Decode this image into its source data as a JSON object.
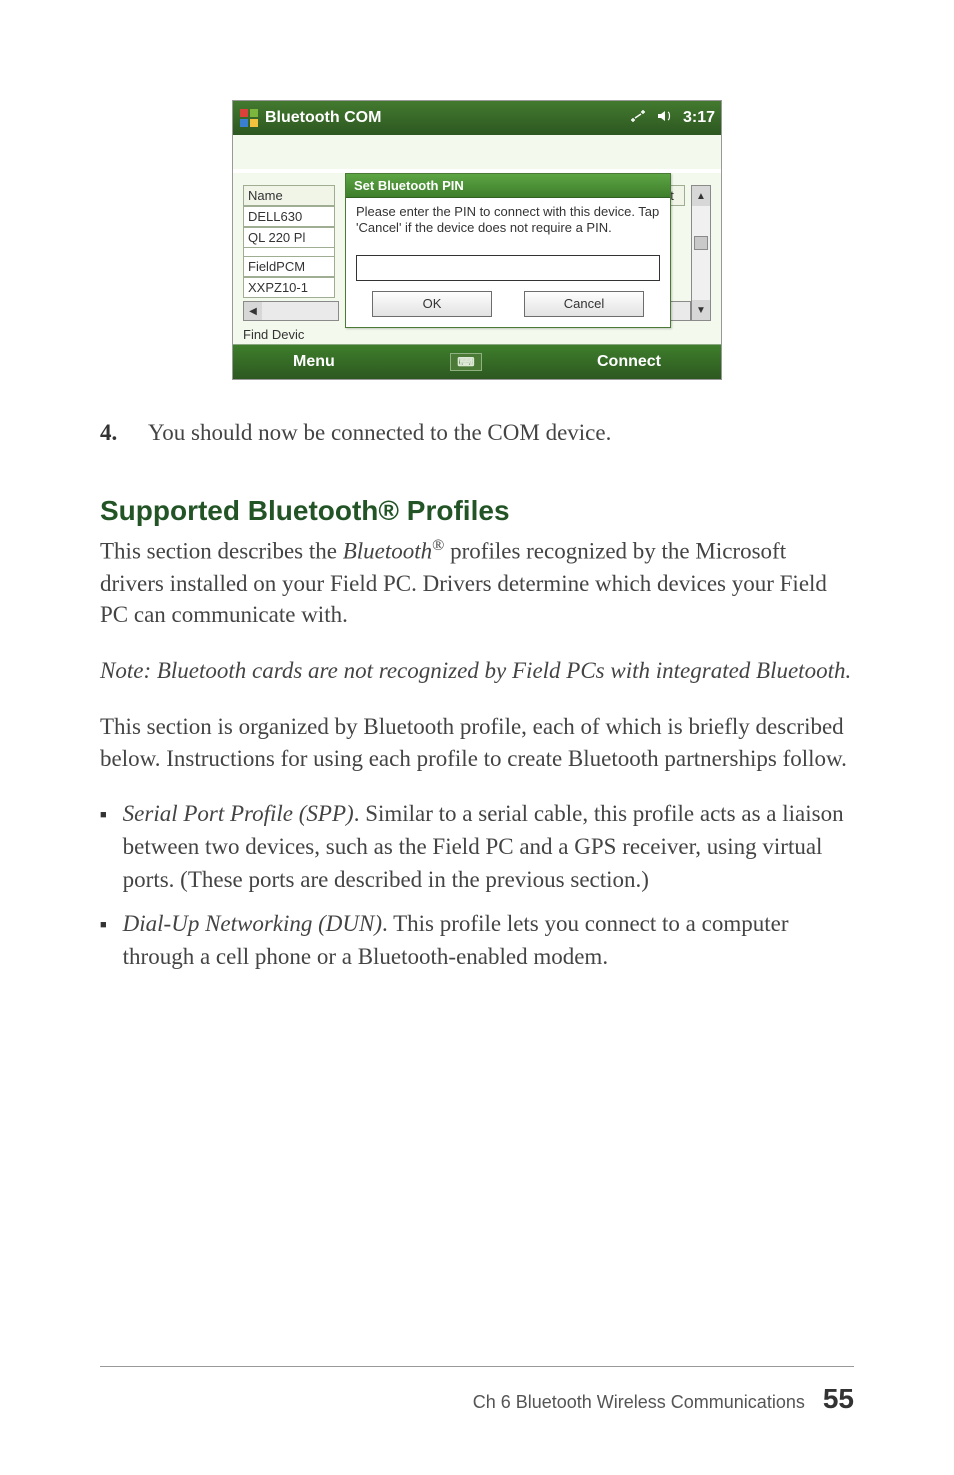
{
  "screenshot": {
    "titlebar": {
      "app": "Bluetooth COM",
      "time": "3:17"
    },
    "table": {
      "name_header": "Name",
      "port_header": "Port",
      "rows": [
        {
          "name": "DELL630"
        },
        {
          "name": "QL 220 Pl"
        },
        {
          "name": "FieldPCM"
        },
        {
          "name": "XXPZ10-1"
        }
      ],
      "find_label": "Find Devic"
    },
    "dialog": {
      "title": "Set Bluetooth PIN",
      "body": "Please enter the PIN to connect with this device. Tap 'Cancel' if the device does not require a PIN.",
      "ok": "OK",
      "cancel": "Cancel"
    },
    "menubar": {
      "left": "Menu",
      "right": "Connect"
    }
  },
  "step4": {
    "num": "4.",
    "text": "You should now be connected to the COM device."
  },
  "heading": "Supported Bluetooth® Profiles",
  "intro": {
    "pre": "This section describes the ",
    "term": "Bluetooth",
    "reg": "®",
    "post": " profiles recognized by the Microsoft drivers installed on your Field PC. Drivers determine which devices your Field PC can communicate with."
  },
  "note": "Note: Bluetooth cards are not recognized by Field PCs with integrated Bluetooth.",
  "para2": "This section is organized by Bluetooth profile, each of which is briefly described below. Instructions for using each profile to create Bluetooth partnerships follow.",
  "bullets": [
    {
      "term": "Serial Port Profile (SPP)",
      "text": ". Similar to a serial cable, this profile acts as a liaison between two devices, such as the Field PC and a GPS receiver, using virtual ports. (These ports are described in the previous section.)"
    },
    {
      "term": "Dial-Up Networking (DUN)",
      "text": ". This profile lets you connect to a computer through a cell phone or a Bluetooth-enabled modem."
    }
  ],
  "footer": {
    "chapter": "Ch 6    Bluetooth Wireless Communications",
    "page": "55"
  }
}
